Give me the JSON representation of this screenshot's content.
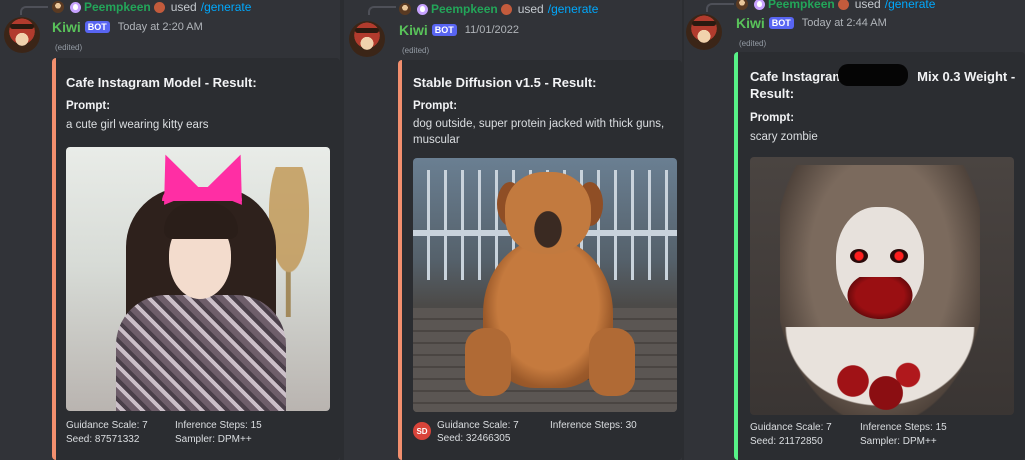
{
  "messages": [
    {
      "reply": {
        "user": "Peempkeen",
        "used": "used",
        "command": "/generate"
      },
      "bot": {
        "name": "Kiwi",
        "tag": "BOT",
        "timestamp": "Today at 2:20 AM",
        "edited": "(edited)"
      },
      "embed": {
        "accent": "#f28f6e",
        "title": "Cafe Instagram Model - Result:",
        "prompt_label": "Prompt:",
        "prompt": "a cute girl wearing kitty ears",
        "guidance": "Guidance Scale: 7",
        "steps": "Inference Steps: 15",
        "seed": "Seed: 87571332",
        "sampler": "Sampler: DPM++"
      }
    },
    {
      "reply": {
        "user": "Peempkeen",
        "used": "used",
        "command": "/generate"
      },
      "bot": {
        "name": "Kiwi",
        "tag": "BOT",
        "timestamp": "11/01/2022",
        "edited": "(edited)"
      },
      "embed": {
        "accent": "#f28f6e",
        "title": "Stable Diffusion v1.5 - Result:",
        "prompt_label": "Prompt:",
        "prompt": "dog outside, super protein jacked with thick guns, muscular",
        "guidance": "Guidance Scale: 7",
        "steps": "Inference Steps: 30",
        "seed": "Seed: 32466305",
        "footer_icon": "SD"
      }
    },
    {
      "reply": {
        "user": "Peempkeen",
        "used": "used",
        "command": "/generate"
      },
      "bot": {
        "name": "Kiwi",
        "tag": "BOT",
        "timestamp": "Today at 2:44 AM",
        "edited": "(edited)"
      },
      "embed": {
        "accent": "#57f287",
        "title_part1": "Cafe Instagram",
        "title_part2": "Mix 0.3 Weight -",
        "title_line2": "Result:",
        "prompt_label": "Prompt:",
        "prompt": "scary zombie",
        "guidance": "Guidance Scale: 7",
        "steps": "Inference Steps: 15",
        "seed": "Seed: 21172850",
        "sampler": "Sampler: DPM++"
      }
    }
  ]
}
